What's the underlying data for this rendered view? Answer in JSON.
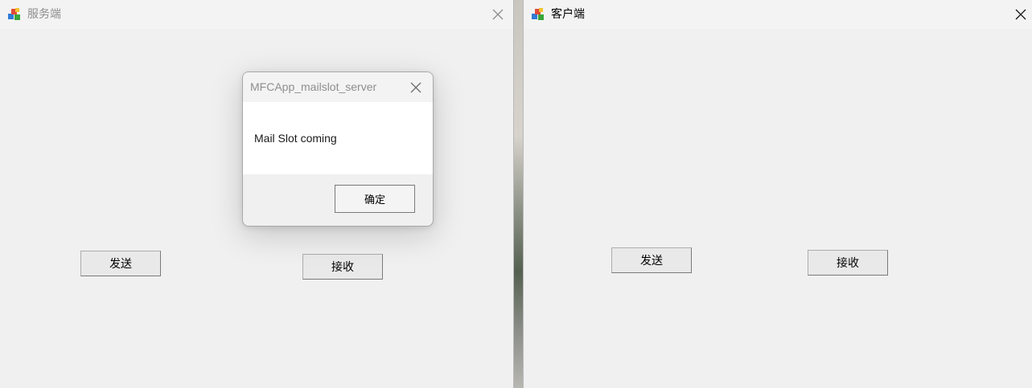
{
  "server_window": {
    "title": "服务端",
    "send_label": "发送",
    "receive_label": "接收"
  },
  "message_box": {
    "title": "MFCApp_mailslot_server",
    "message": "Mail Slot coming",
    "ok_label": "确定"
  },
  "client_window": {
    "title": "客户端",
    "send_label": "发送",
    "receive_label": "接收"
  },
  "icons": {
    "app": "mfc-app-icon",
    "close": "close-icon"
  }
}
